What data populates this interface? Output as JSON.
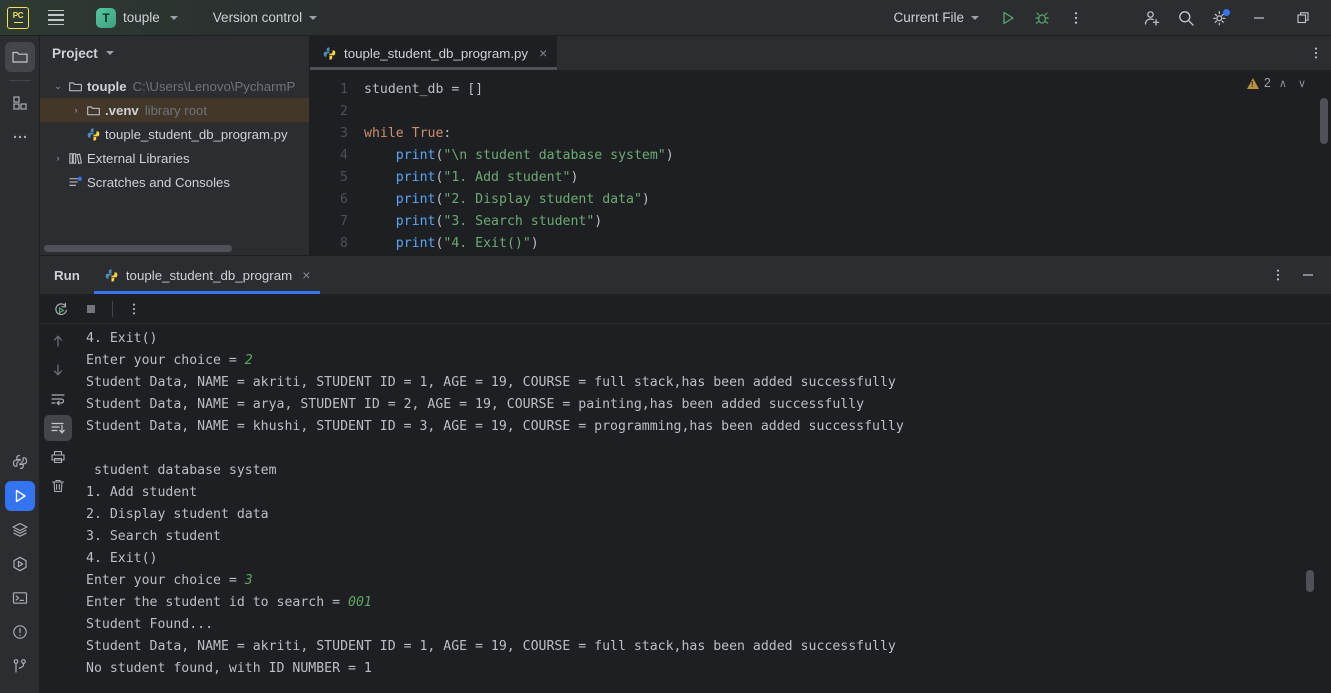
{
  "titlebar": {
    "logo_icon": "pycharm-logo-icon",
    "menu_icon": "hamburger-menu-icon",
    "project_initial": "T",
    "project_name": "touple",
    "version_control": "Version control",
    "run_config": "Current File",
    "run_icon": "run-icon",
    "debug_icon": "debug-icon",
    "more_icon": "more-vertical-icon",
    "account_icon": "add-account-icon",
    "search_icon": "search-icon",
    "settings_icon": "gear-icon",
    "minimize_icon": "minimize-icon",
    "restore_icon": "restore-window-icon",
    "accent": "#3574f0"
  },
  "toolstrip": {
    "items": [
      {
        "name": "project-tool-icon",
        "label": "Project",
        "state": "active"
      },
      {
        "name": "structure-tool-icon",
        "label": "Structure",
        "state": "normal"
      },
      {
        "name": "more-tool-icon",
        "label": "More tool windows",
        "state": "normal"
      }
    ],
    "bottom_items": [
      {
        "name": "python-packages-icon",
        "label": "Python Packages",
        "state": "normal"
      },
      {
        "name": "run-tool-icon",
        "label": "Run",
        "state": "accent"
      },
      {
        "name": "layers-icon",
        "label": "Version Control Layers",
        "state": "normal"
      },
      {
        "name": "services-icon",
        "label": "Services",
        "state": "normal"
      },
      {
        "name": "terminal-icon",
        "label": "Terminal",
        "state": "normal"
      },
      {
        "name": "problems-icon",
        "label": "Problems",
        "state": "normal"
      },
      {
        "name": "git-branch-icon",
        "label": "Git",
        "state": "normal"
      }
    ]
  },
  "project_panel": {
    "title": "Project",
    "tree": [
      {
        "indent": 0,
        "arrow": "down",
        "icon": "folder-icon",
        "label": "touple",
        "suffix": "C:\\Users\\Lenovo\\PycharmP",
        "bold": true,
        "selected": false
      },
      {
        "indent": 1,
        "arrow": "right",
        "icon": "folder-icon",
        "label": ".venv",
        "suffix": "library root",
        "bold": true,
        "selected": true
      },
      {
        "indent": 1,
        "arrow": "none",
        "icon": "python-file-icon",
        "label": "touple_student_db_program.py",
        "suffix": "",
        "bold": false,
        "selected": false
      },
      {
        "indent": 0,
        "arrow": "right",
        "icon": "library-icon",
        "label": "External Libraries",
        "suffix": "",
        "bold": false,
        "selected": false
      },
      {
        "indent": 0,
        "arrow": "none",
        "icon": "scratches-icon",
        "label": "Scratches and Consoles",
        "suffix": "",
        "bold": false,
        "selected": false
      }
    ]
  },
  "editor": {
    "tab": {
      "icon": "python-file-icon",
      "label": "touple_student_db_program.py",
      "close": "×"
    },
    "options_icon": "more-vertical-icon",
    "inspections": {
      "icon": "warning-triangle-icon",
      "count": "2",
      "up": "∧",
      "down": "∨"
    },
    "lines": [
      {
        "n": "1",
        "tokens": [
          {
            "t": "plain",
            "v": "student_db = []"
          }
        ]
      },
      {
        "n": "2",
        "tokens": [
          {
            "t": "plain",
            "v": ""
          }
        ]
      },
      {
        "n": "3",
        "tokens": [
          {
            "t": "kw",
            "v": "while"
          },
          {
            "t": "plain",
            "v": " "
          },
          {
            "t": "kw",
            "v": "True"
          },
          {
            "t": "plain",
            "v": ":"
          }
        ]
      },
      {
        "n": "4",
        "tokens": [
          {
            "t": "plain",
            "v": "    "
          },
          {
            "t": "fn",
            "v": "print"
          },
          {
            "t": "plain",
            "v": "("
          },
          {
            "t": "str",
            "v": "\"\\n student database system\""
          },
          {
            "t": "plain",
            "v": ")"
          }
        ]
      },
      {
        "n": "5",
        "tokens": [
          {
            "t": "plain",
            "v": "    "
          },
          {
            "t": "fn",
            "v": "print"
          },
          {
            "t": "plain",
            "v": "("
          },
          {
            "t": "str",
            "v": "\"1. Add student\""
          },
          {
            "t": "plain",
            "v": ")"
          }
        ]
      },
      {
        "n": "6",
        "tokens": [
          {
            "t": "plain",
            "v": "    "
          },
          {
            "t": "fn",
            "v": "print"
          },
          {
            "t": "plain",
            "v": "("
          },
          {
            "t": "str",
            "v": "\"2. Display student data\""
          },
          {
            "t": "plain",
            "v": ")"
          }
        ]
      },
      {
        "n": "7",
        "tokens": [
          {
            "t": "plain",
            "v": "    "
          },
          {
            "t": "fn",
            "v": "print"
          },
          {
            "t": "plain",
            "v": "("
          },
          {
            "t": "str",
            "v": "\"3. Search student\""
          },
          {
            "t": "plain",
            "v": ")"
          }
        ]
      },
      {
        "n": "8",
        "tokens": [
          {
            "t": "plain",
            "v": "    "
          },
          {
            "t": "fn",
            "v": "print"
          },
          {
            "t": "plain",
            "v": "("
          },
          {
            "t": "str",
            "v": "\"4. Exit()\""
          },
          {
            "t": "plain",
            "v": ")"
          }
        ]
      }
    ]
  },
  "run_window": {
    "title": "Run",
    "tab": {
      "icon": "python-file-icon",
      "label": "touple_student_db_program",
      "close": "×"
    },
    "options_icon": "more-vertical-icon",
    "minimize_icon": "minimize-icon",
    "toolbar": [
      {
        "name": "rerun-icon",
        "label": "Rerun",
        "state": "normal"
      },
      {
        "name": "stop-icon",
        "label": "Stop",
        "state": "normal"
      },
      {
        "name": "more-vertical-icon",
        "label": "More",
        "state": "normal"
      }
    ],
    "side_toolbar": [
      {
        "name": "up-arrow-icon",
        "label": "Previous occurrence",
        "state": "normal"
      },
      {
        "name": "down-arrow-icon",
        "label": "Next occurrence",
        "state": "normal"
      },
      {
        "name": "soft-wrap-icon",
        "label": "Soft-Wrap",
        "state": "normal"
      },
      {
        "name": "scroll-to-end-icon",
        "label": "Scroll to End",
        "state": "active"
      },
      {
        "name": "print-icon",
        "label": "Print",
        "state": "normal"
      },
      {
        "name": "trash-icon",
        "label": "Clear All",
        "state": "normal"
      }
    ],
    "console": [
      {
        "segments": [
          {
            "t": "out",
            "v": "4. Exit()"
          }
        ]
      },
      {
        "segments": [
          {
            "t": "out",
            "v": "Enter your choice = "
          },
          {
            "t": "in",
            "v": "2"
          }
        ]
      },
      {
        "segments": [
          {
            "t": "out",
            "v": "Student Data, NAME = akriti, STUDENT ID = 1, AGE = 19, COURSE = full stack,has been added successfully"
          }
        ]
      },
      {
        "segments": [
          {
            "t": "out",
            "v": "Student Data, NAME = arya, STUDENT ID = 2, AGE = 19, COURSE = painting,has been added successfully"
          }
        ]
      },
      {
        "segments": [
          {
            "t": "out",
            "v": "Student Data, NAME = khushi, STUDENT ID = 3, AGE = 19, COURSE = programming,has been added successfully"
          }
        ]
      },
      {
        "segments": [
          {
            "t": "out",
            "v": ""
          }
        ]
      },
      {
        "segments": [
          {
            "t": "out",
            "v": " student database system"
          }
        ]
      },
      {
        "segments": [
          {
            "t": "out",
            "v": "1. Add student"
          }
        ]
      },
      {
        "segments": [
          {
            "t": "out",
            "v": "2. Display student data"
          }
        ]
      },
      {
        "segments": [
          {
            "t": "out",
            "v": "3. Search student"
          }
        ]
      },
      {
        "segments": [
          {
            "t": "out",
            "v": "4. Exit()"
          }
        ]
      },
      {
        "segments": [
          {
            "t": "out",
            "v": "Enter your choice = "
          },
          {
            "t": "in",
            "v": "3"
          }
        ]
      },
      {
        "segments": [
          {
            "t": "out",
            "v": "Enter the student id to search = "
          },
          {
            "t": "in",
            "v": "001"
          }
        ]
      },
      {
        "segments": [
          {
            "t": "out",
            "v": "Student Found..."
          }
        ]
      },
      {
        "segments": [
          {
            "t": "out",
            "v": "Student Data, NAME = akriti, STUDENT ID = 1, AGE = 19, COURSE = full stack,has been added successfully"
          }
        ]
      },
      {
        "segments": [
          {
            "t": "out",
            "v": "No student found, with ID NUMBER = 1"
          }
        ]
      }
    ]
  }
}
